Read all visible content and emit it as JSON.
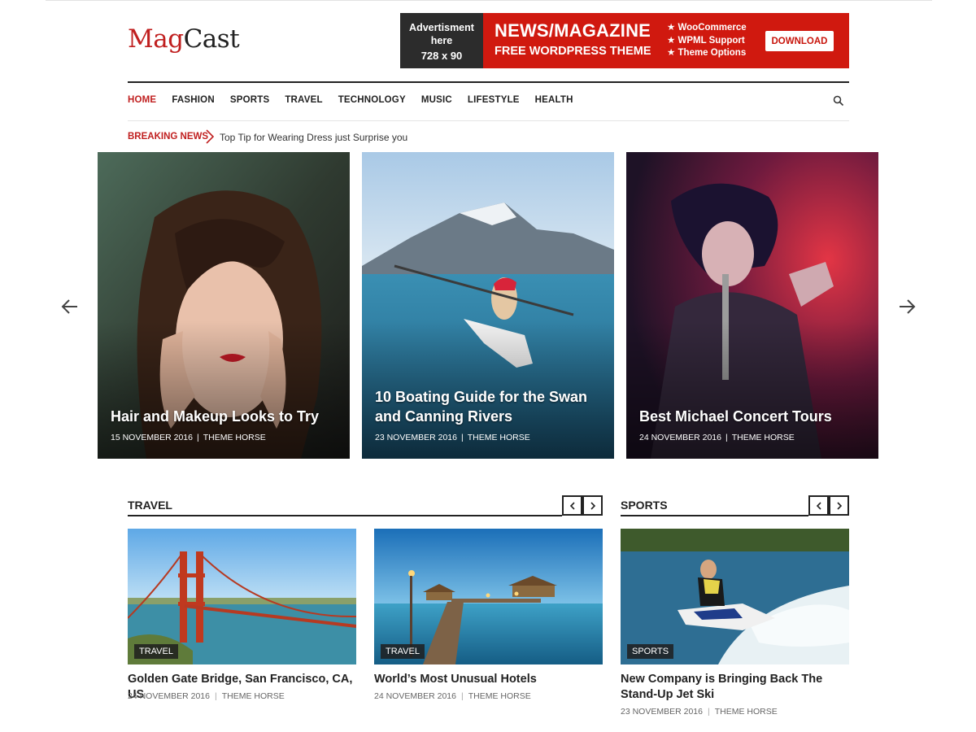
{
  "site": {
    "logo_part1": "Mag",
    "logo_part2": "Cast"
  },
  "ad": {
    "left_line1": "Advertisment",
    "left_line2": "here",
    "left_size": "728 x 90",
    "headline": "NEWS/MAGAZINE",
    "subheadline": "FREE WORDPRESS THEME",
    "features": [
      "WooCommerce",
      "WPML Support",
      "Theme Options"
    ],
    "button": "DOWNLOAD",
    "color": "#d0190f"
  },
  "nav": {
    "items": [
      "HOME",
      "FASHION",
      "SPORTS",
      "TRAVEL",
      "TECHNOLOGY",
      "MUSIC",
      "LIFESTYLE",
      "HEALTH"
    ],
    "active_index": 0,
    "search_icon": "search-icon"
  },
  "breaking": {
    "label": "BREAKING NEWS",
    "text": "Top Tip for Wearing Dress just Surprise you"
  },
  "slider": {
    "slides": [
      {
        "title": "Hair and Makeup Looks to Try",
        "date": "15 NOVEMBER 2016",
        "author": "THEME HORSE"
      },
      {
        "title": "10 Boating Guide for the Swan and Canning Rivers",
        "date": "23 NOVEMBER 2016",
        "author": "THEME HORSE"
      },
      {
        "title": "Best Michael Concert Tours",
        "date": "24 NOVEMBER 2016",
        "author": "THEME HORSE"
      }
    ]
  },
  "sections": {
    "travel": {
      "title": "TRAVEL"
    },
    "sports": {
      "title": "SPORTS"
    }
  },
  "cards": [
    {
      "tag": "TRAVEL",
      "title": "Golden Gate Bridge, San Francisco, CA, US",
      "date": "24 NOVEMBER 2016",
      "author": "THEME HORSE"
    },
    {
      "tag": "TRAVEL",
      "title": "World’s Most Unusual Hotels",
      "date": "24 NOVEMBER 2016",
      "author": "THEME HORSE"
    },
    {
      "tag": "SPORTS",
      "title": "New Company is Bringing Back The Stand-Up Jet Ski",
      "date": "23 NOVEMBER 2016",
      "author": "THEME HORSE"
    }
  ],
  "colors": {
    "accent": "#c01f1f",
    "text": "#222222"
  }
}
